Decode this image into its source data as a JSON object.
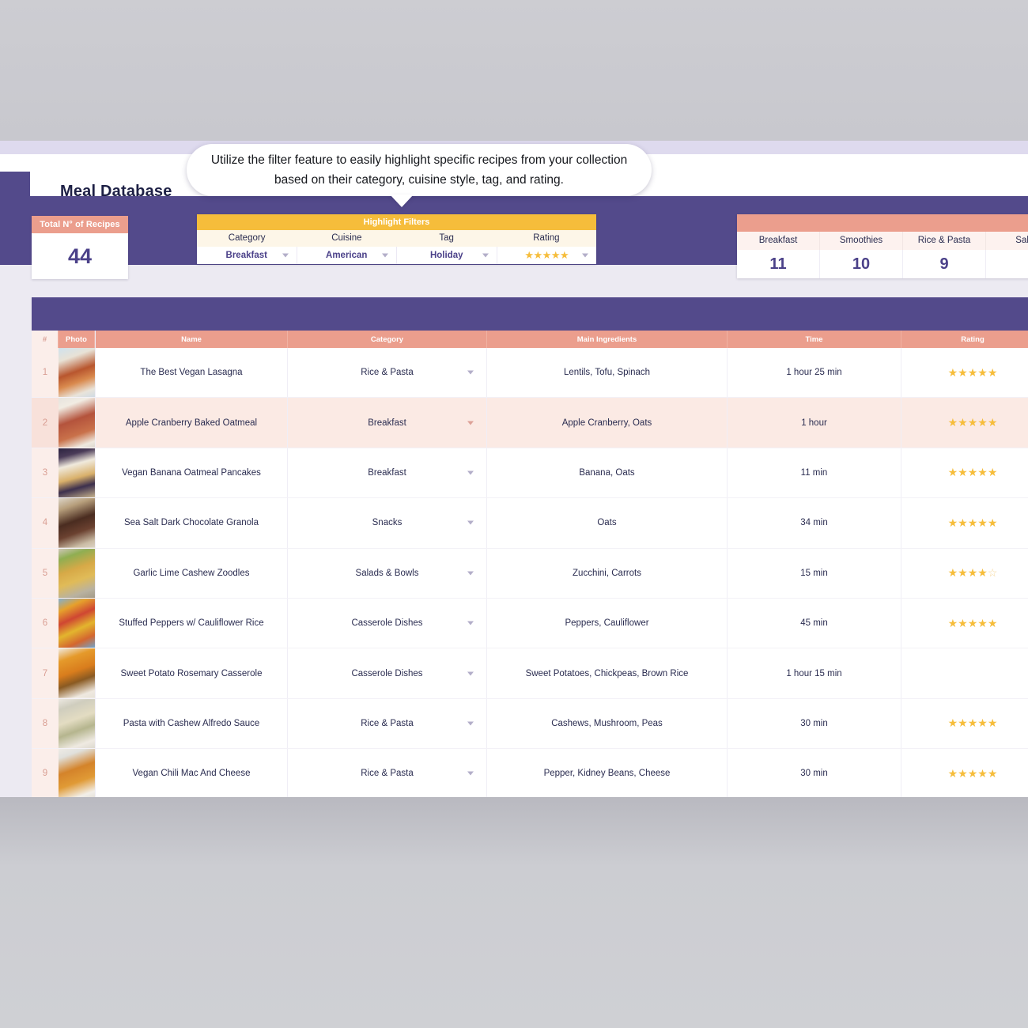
{
  "app": {
    "title": "Meal Database",
    "accent_purple": "#534a8b",
    "accent_salmon": "#eb9e8d",
    "accent_yellow": "#f6bd3b"
  },
  "tooltip": {
    "text": "Utilize the filter feature to easily highlight specific recipes from your collection based on their category, cuisine style, tag, and rating."
  },
  "kpi_total": {
    "label": "Total N° of Recipes",
    "value": "44"
  },
  "filters": {
    "title": "Highlight Filters",
    "fields": [
      {
        "label": "Category",
        "value": "Breakfast",
        "type": "select"
      },
      {
        "label": "Cuisine",
        "value": "American",
        "type": "select"
      },
      {
        "label": "Tag",
        "value": "Holiday",
        "type": "select"
      },
      {
        "label": "Rating",
        "value": "★★★★★",
        "type": "stars"
      }
    ]
  },
  "category_counts": [
    {
      "label": "Breakfast",
      "value": "11"
    },
    {
      "label": "Smoothies",
      "value": "10"
    },
    {
      "label": "Rice & Pasta",
      "value": "9"
    },
    {
      "label": "Salad",
      "value": ""
    }
  ],
  "table": {
    "columns": [
      "#",
      "Photo",
      "Name",
      "Category",
      "Main Ingredients",
      "Time",
      "Rating"
    ],
    "rows": [
      {
        "num": "1",
        "name": "The Best Vegan Lasagna",
        "category": "Rice & Pasta",
        "ingredients": "Lentils, Tofu, Spinach",
        "time": "1 hour 25 min",
        "rating": 5,
        "highlight": false,
        "photo": "lasagna"
      },
      {
        "num": "2",
        "name": "Apple Cranberry Baked Oatmeal",
        "category": "Breakfast",
        "ingredients": "Apple Cranberry, Oats",
        "time": "1 hour",
        "rating": 5,
        "highlight": true,
        "photo": "baked-oatmeal"
      },
      {
        "num": "3",
        "name": "Vegan Banana Oatmeal Pancakes",
        "category": "Breakfast",
        "ingredients": "Banana, Oats",
        "time": "11 min",
        "rating": 5,
        "highlight": false,
        "photo": "pancakes"
      },
      {
        "num": "4",
        "name": "Sea Salt Dark Chocolate Granola",
        "category": "Snacks",
        "ingredients": "Oats",
        "time": "34 min",
        "rating": 5,
        "highlight": false,
        "photo": "granola"
      },
      {
        "num": "5",
        "name": "Garlic Lime Cashew Zoodles",
        "category": "Salads & Bowls",
        "ingredients": "Zucchini, Carrots",
        "time": "15 min",
        "rating": 4,
        "highlight": false,
        "photo": "zoodles"
      },
      {
        "num": "6",
        "name": "Stuffed Peppers w/ Cauliflower Rice",
        "category": "Casserole Dishes",
        "ingredients": "Peppers, Cauliflower",
        "time": "45 min",
        "rating": 5,
        "highlight": false,
        "photo": "peppers"
      },
      {
        "num": "7",
        "name": "Sweet Potato Rosemary Casserole",
        "category": "Casserole Dishes",
        "ingredients": "Sweet Potatoes, Chickpeas, Brown Rice",
        "time": "1 hour 15 min",
        "rating": 0,
        "highlight": false,
        "photo": "casserole"
      },
      {
        "num": "8",
        "name": "Pasta with Cashew Alfredo Sauce",
        "category": "Rice & Pasta",
        "ingredients": "Cashews, Mushroom, Peas",
        "time": "30 min",
        "rating": 5,
        "highlight": false,
        "photo": "alfredo"
      },
      {
        "num": "9",
        "name": "Vegan Chili Mac And Cheese",
        "category": "Rice & Pasta",
        "ingredients": "Pepper, Kidney Beans, Cheese",
        "time": "30 min",
        "rating": 5,
        "highlight": false,
        "photo": "chilimac"
      }
    ]
  }
}
